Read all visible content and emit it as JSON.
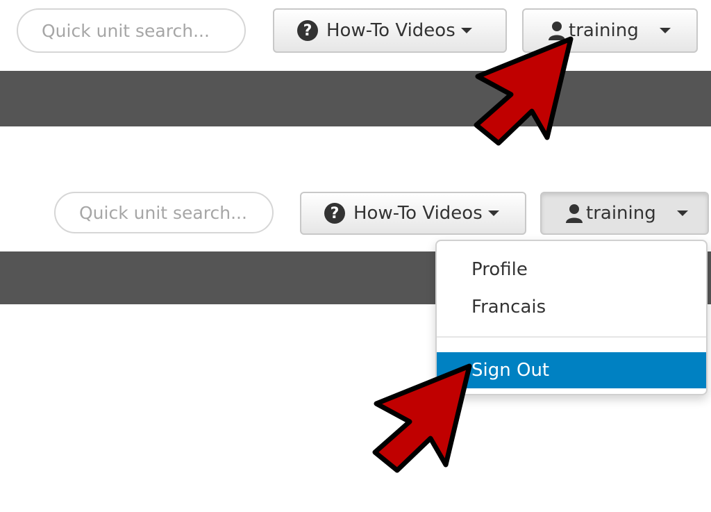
{
  "panel_before": {
    "search": {
      "placeholder": "Quick unit search..."
    },
    "help_button": {
      "label": "How-To Videos",
      "icon": "question-circle-icon"
    },
    "user_button": {
      "label": "training",
      "icon": "user-icon"
    }
  },
  "panel_after": {
    "search": {
      "placeholder": "Quick unit search..."
    },
    "help_button": {
      "label": "How-To Videos",
      "icon": "question-circle-icon"
    },
    "user_button": {
      "label": "training",
      "icon": "user-icon"
    },
    "user_menu": {
      "items": [
        {
          "label": "Profile"
        },
        {
          "label": "Francais"
        }
      ],
      "sign_out": {
        "label": "Sign Out",
        "highlighted": true
      }
    }
  },
  "colors": {
    "band": "#555555",
    "highlight": "#0081c2",
    "arrow_fill": "#c00000",
    "arrow_outline": "#000000"
  }
}
